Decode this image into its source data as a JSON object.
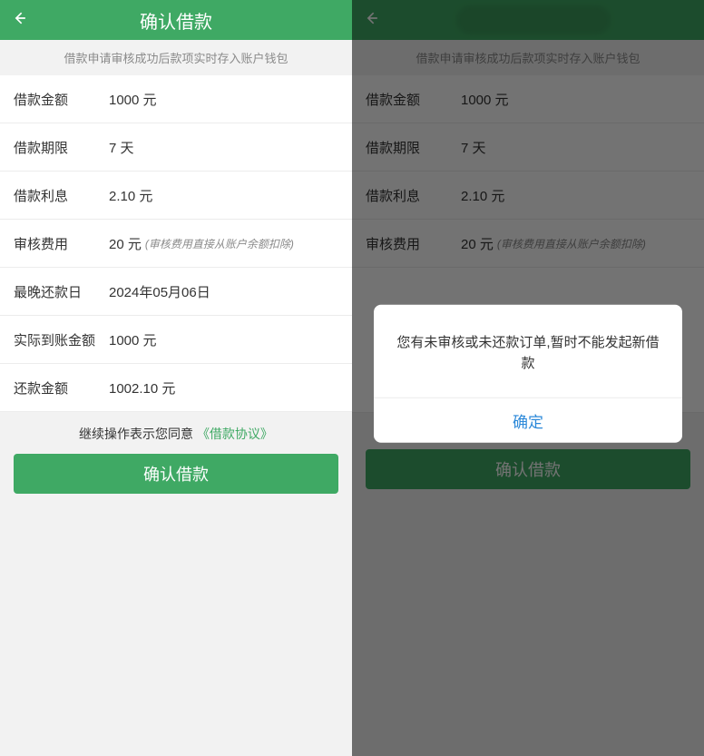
{
  "left": {
    "header_title": "确认借款",
    "notice": "借款申请审核成功后款项实时存入账户钱包",
    "rows": [
      {
        "label": "借款金额",
        "value": "1000 元"
      },
      {
        "label": "借款期限",
        "value": "7 天"
      },
      {
        "label": "借款利息",
        "value": "2.10 元"
      },
      {
        "label": "审核费用",
        "value": "20 元",
        "note": "(审核费用直接从账户余额扣除)"
      },
      {
        "label": "最晚还款日",
        "value": "2024年05月06日"
      },
      {
        "label": "实际到账金额",
        "value": "1000 元"
      },
      {
        "label": "还款金额",
        "value": "1002.10 元"
      }
    ],
    "agree_text": "继续操作表示您同意",
    "agree_link": "《借款协议》",
    "confirm_btn": "确认借款"
  },
  "right": {
    "notice": "借款申请审核成功后款项实时存入账户钱包",
    "rows": [
      {
        "label": "借款金额",
        "value": "1000 元"
      },
      {
        "label": "借款期限",
        "value": "7 天"
      },
      {
        "label": "借款利息",
        "value": "2.10 元"
      },
      {
        "label": "审核费用",
        "value": "20 元",
        "note": "(审核费用直接从账户余额扣除)"
      }
    ],
    "confirm_btn": "确认借款",
    "modal_text": "您有未审核或未还款订单,暂时不能发起新借款",
    "modal_btn": "确定"
  }
}
